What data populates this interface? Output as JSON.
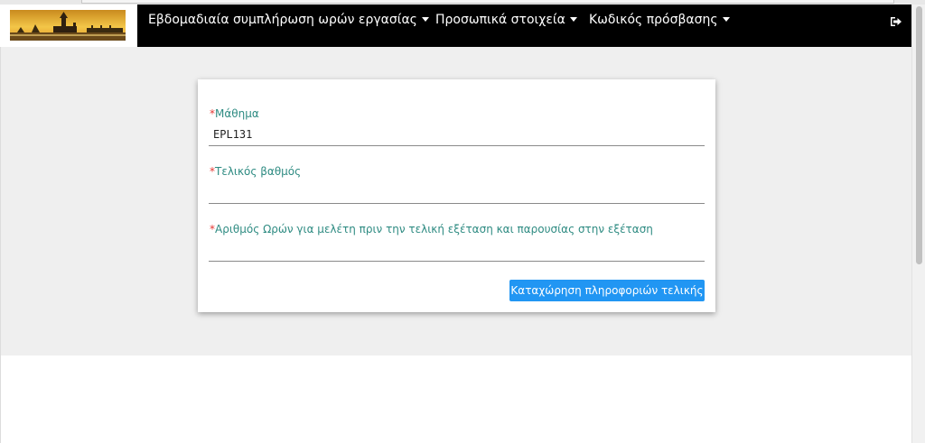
{
  "nav": {
    "weekly_hours": "Εβδομαδιαία συμπλήρωση ωρών εργασίας",
    "personal_info": "Προσωπικά στοιχεία",
    "password": "Κωδικός πρόσβασης",
    "logout_icon": "sign-out-icon",
    "bar_color": "#000000"
  },
  "form": {
    "course_label": "Μάθημα",
    "course_value": "EPL131",
    "final_grade_label": "Τελικός βαθμός",
    "final_grade_value": "",
    "study_hours_label": "Αριθμός Ωρών για μελέτη πριν την τελική εξέταση και παρουσίας στην εξέταση",
    "study_hours_value": "",
    "required_marker": "*",
    "submit_label": "Καταχώρηση πληροφοριών τελικής",
    "accent_color": "#2196f3",
    "label_color": "#2e8b82",
    "required_color": "#e53935"
  }
}
